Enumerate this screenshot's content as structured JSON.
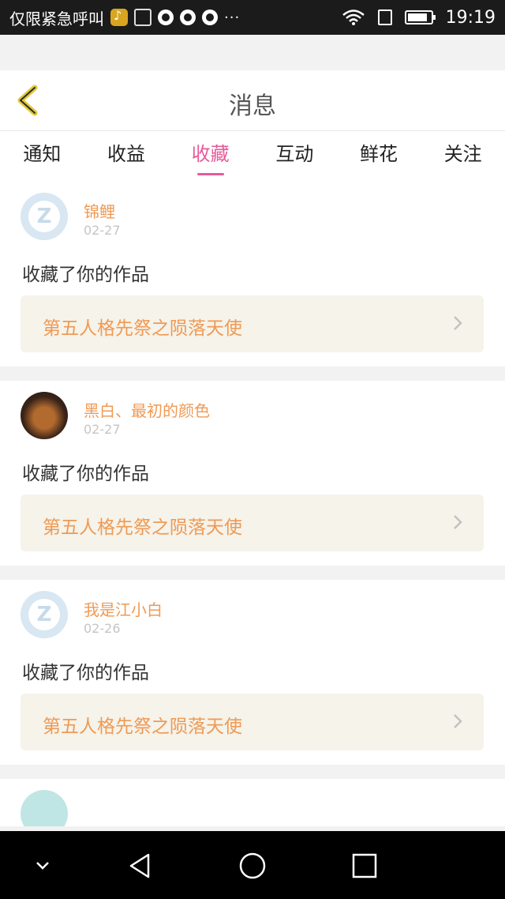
{
  "status_bar": {
    "carrier": "仅限紧急呼叫",
    "more_dots": "···",
    "time": "19:19"
  },
  "header": {
    "title": "消息"
  },
  "tabs": [
    {
      "label": "通知",
      "active": false
    },
    {
      "label": "收益",
      "active": false
    },
    {
      "label": "收藏",
      "active": true
    },
    {
      "label": "互动",
      "active": false
    },
    {
      "label": "鲜花",
      "active": false
    },
    {
      "label": "关注",
      "active": false
    }
  ],
  "feed": [
    {
      "user": "锦鲤",
      "date": "02-27",
      "action": "收藏了你的作品",
      "work": "第五人格先祭之陨落天使"
    },
    {
      "user": "黑白、最初的颜色",
      "date": "02-27",
      "action": "收藏了你的作品",
      "work": "第五人格先祭之陨落天使"
    },
    {
      "user": "我是江小白",
      "date": "02-26",
      "action": "收藏了你的作品",
      "work": "第五人格先祭之陨落天使"
    }
  ],
  "colors": {
    "accent": "#e75a9b",
    "username": "#ef9a55",
    "work_bg": "#f5f3ea"
  }
}
